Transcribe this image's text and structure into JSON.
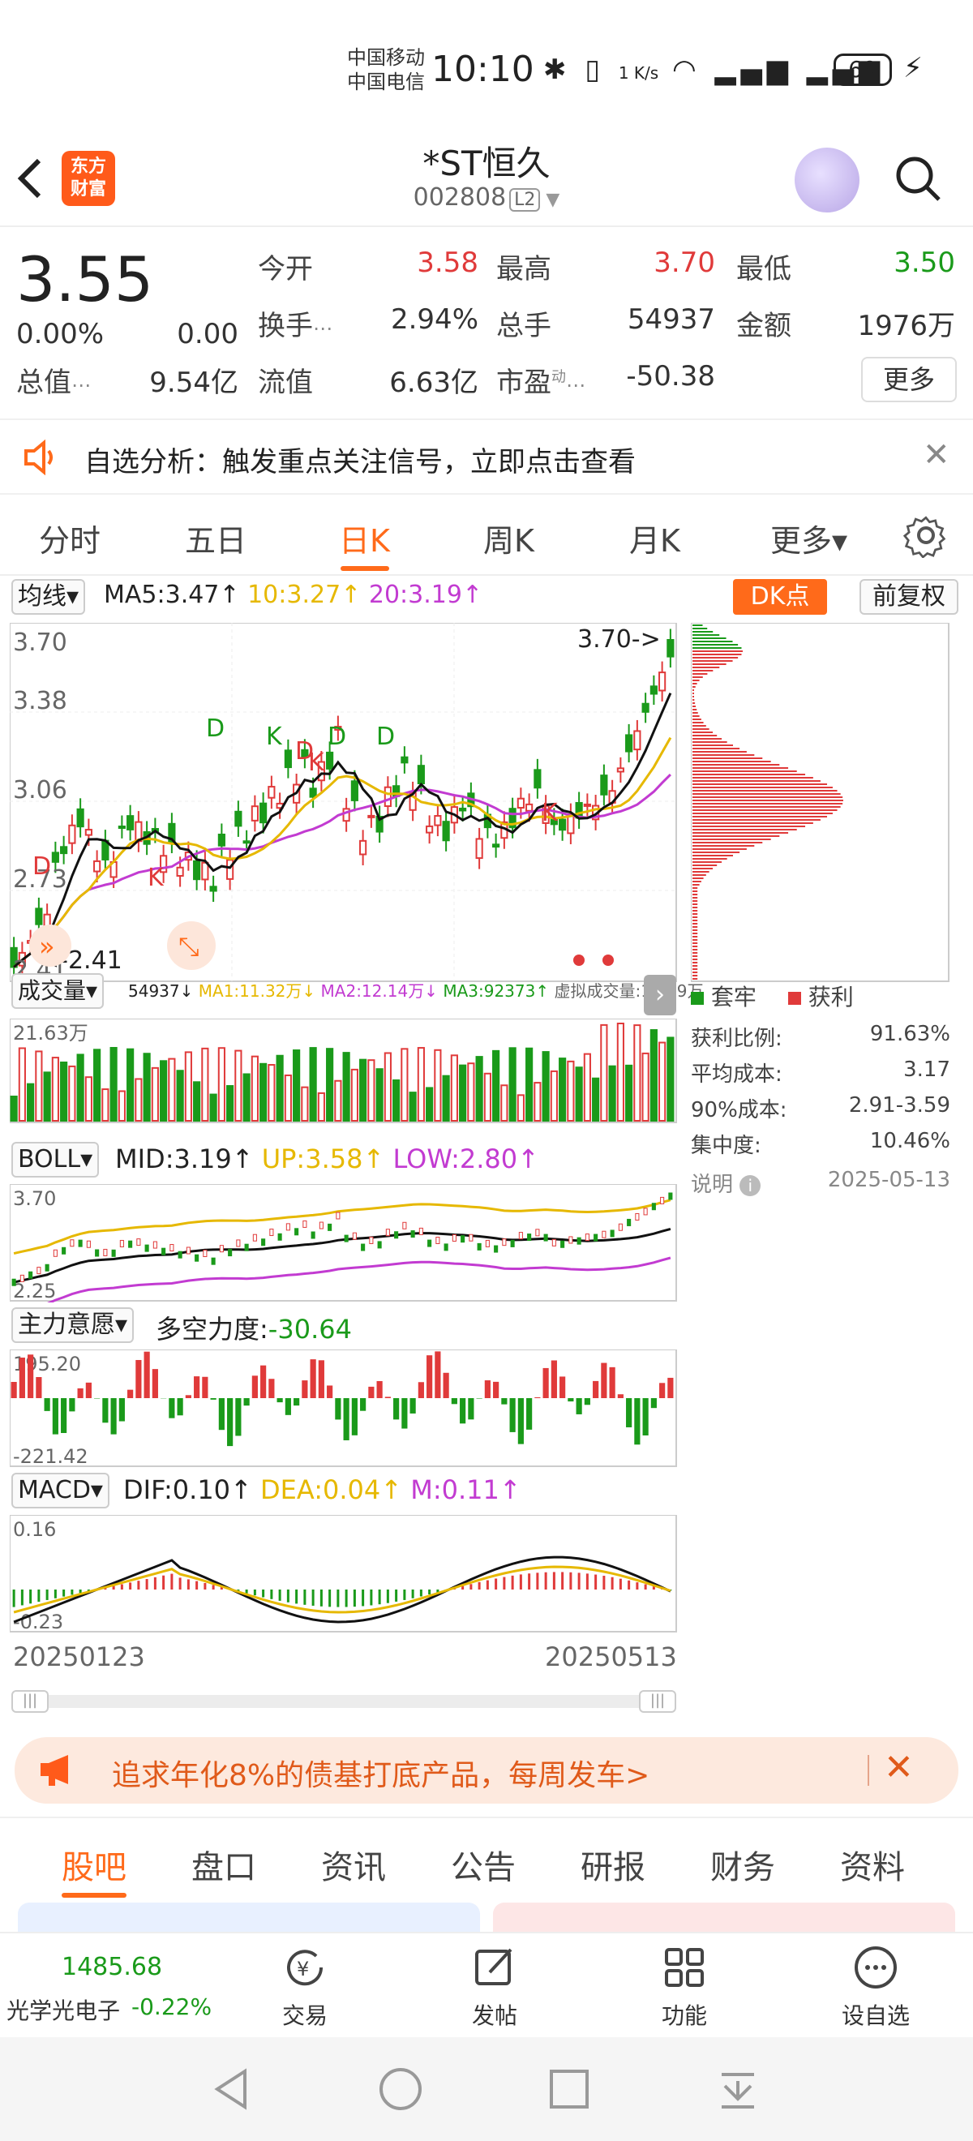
{
  "status_bar": {
    "carrier1": "中国移动",
    "carrier2": "中国电信",
    "time": "10:10",
    "speed": "1 K/s",
    "battery": "69"
  },
  "header": {
    "logo_text": "东方财富",
    "title": "*ST恒久",
    "code": "002808",
    "level": "L2"
  },
  "quote": {
    "price": "3.55",
    "change_pct": "0.00%",
    "change_val": "0.00",
    "fields": [
      {
        "label": "今开",
        "value": "3.58",
        "color": "red"
      },
      {
        "label": "最高",
        "value": "3.70",
        "color": "red"
      },
      {
        "label": "最低",
        "value": "3.50",
        "color": "green"
      },
      {
        "label": "换手",
        "value": "2.94%",
        "color": "gray"
      },
      {
        "label": "总手",
        "value": "54937",
        "color": "gray"
      },
      {
        "label": "金额",
        "value": "1976万",
        "color": "gray"
      },
      {
        "label": "总值",
        "value": "9.54亿",
        "color": "gray"
      },
      {
        "label": "流值",
        "value": "6.63亿",
        "color": "gray"
      },
      {
        "label": "市盈",
        "value": "-50.38",
        "color": "gray"
      }
    ],
    "pe_sup": "动",
    "more_label": "更多"
  },
  "banner1": {
    "text": "自选分析：触发重点关注信号，立即点击查看"
  },
  "period_tabs": [
    {
      "label": "分时",
      "active": false
    },
    {
      "label": "五日",
      "active": false
    },
    {
      "label": "日K",
      "active": true
    },
    {
      "label": "周K",
      "active": false
    },
    {
      "label": "月K",
      "active": false
    },
    {
      "label": "更多▾",
      "active": false
    }
  ],
  "kline": {
    "select_label": "均线▾",
    "ma5": "MA5:3.47↑",
    "ma10": "10:3.27↑",
    "ma20": "20:3.19↑",
    "dk_label": "DK点",
    "fq_label": "前复权",
    "y_top": "3.70",
    "y_mid1": "3.38",
    "y_mid2": "3.06",
    "y_mid3": "2.73",
    "y_bottom": "2.41",
    "max_label": "3.70->",
    "min_label": "<-2.41",
    "markers": [
      "D",
      "K",
      "D",
      "K",
      "D",
      "K",
      "D"
    ],
    "colors": {
      "up": "#e03a3a",
      "down": "#1a9a1a",
      "ma5": "#111111",
      "ma10": "#e6b800",
      "ma20": "#c23bd1"
    }
  },
  "volume": {
    "select_label": "成交量▾",
    "summary": "54937↓",
    "ma1": "MA1:11.32万↓",
    "ma2": "MA2:12.14万↓",
    "ma3": "MA3:92373↑",
    "virtual": "虚拟成交量:12.09万",
    "y_top": "21.63万"
  },
  "boll": {
    "select_label": "BOLL▾",
    "mid": "MID:3.19↑",
    "up": "UP:3.58↑",
    "low": "LOW:2.80↑",
    "y_top": "3.70",
    "y_bottom": "2.25"
  },
  "zlyy": {
    "select_label": "主力意愿▾",
    "label": "多空力度:",
    "value": "-30.64",
    "y_top": "195.20",
    "y_bottom": "-221.42"
  },
  "macd": {
    "select_label": "MACD▾",
    "dif": "DIF:0.10↑",
    "dea": "DEA:0.04↑",
    "m": "M:0.11↑",
    "y_top": "0.16",
    "y_bottom": "-0.23"
  },
  "dates": {
    "start": "20250123",
    "end": "20250513"
  },
  "distribution": {
    "legend_trapped": "套牢",
    "legend_profit": "获利",
    "rows": [
      {
        "label": "获利比例:",
        "value": "91.63%"
      },
      {
        "label": "平均成本:",
        "value": "3.17"
      },
      {
        "label": "90%成本:",
        "value": "2.91-3.59"
      },
      {
        "label": "集中度:",
        "value": "10.46%"
      }
    ],
    "note_label": "说明",
    "note_date": "2025-05-13"
  },
  "banner2": {
    "text": "追求年化8%的债基打底产品，每周发车>"
  },
  "bottom_tabs": [
    {
      "label": "股吧",
      "active": true
    },
    {
      "label": "盘口",
      "active": false
    },
    {
      "label": "资讯",
      "active": false
    },
    {
      "label": "公告",
      "active": false
    },
    {
      "label": "研报",
      "active": false
    },
    {
      "label": "财务",
      "active": false
    },
    {
      "label": "资料",
      "active": false
    }
  ],
  "bottom_nav": {
    "index_value": "1485.68",
    "index_name": "光学光电子",
    "index_change": "-0.22%",
    "items": [
      {
        "label": "交易",
        "icon": "trade-icon"
      },
      {
        "label": "发帖",
        "icon": "post-icon"
      },
      {
        "label": "功能",
        "icon": "function-icon"
      },
      {
        "label": "设自选",
        "icon": "watchlist-icon"
      }
    ]
  }
}
